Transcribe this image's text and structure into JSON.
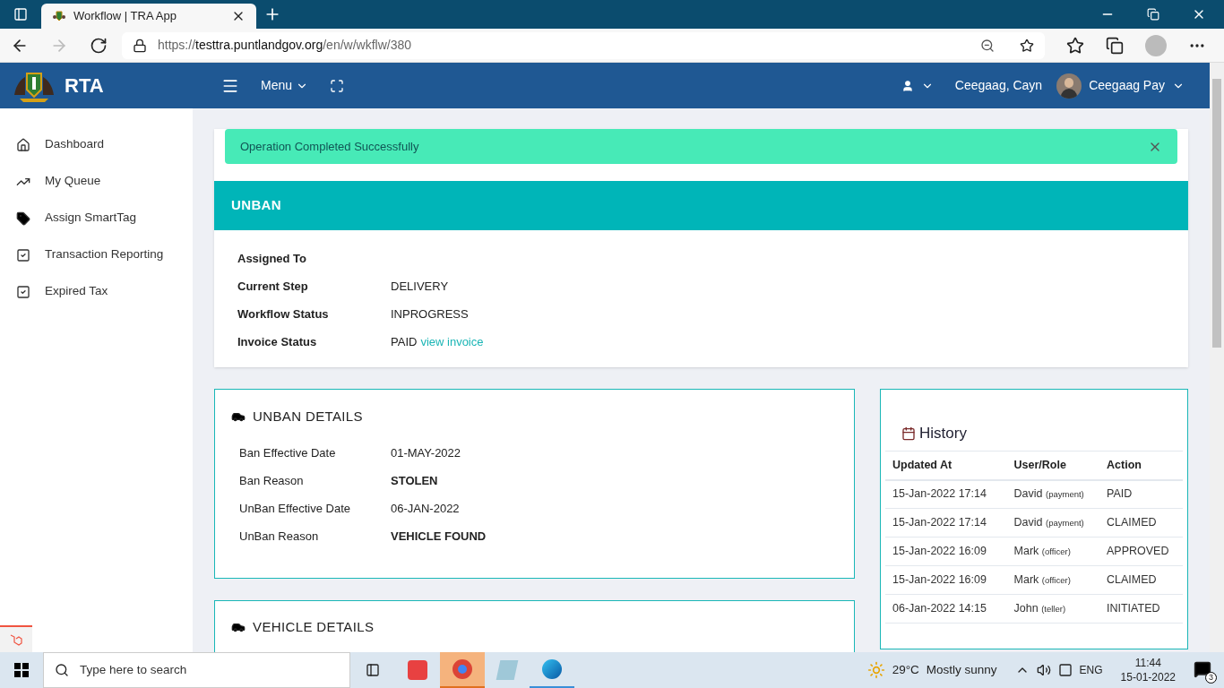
{
  "browser": {
    "tab_title": "Workflow | TRA App",
    "url_scheme": "https://",
    "url_host": "testtra.puntlandgov.org",
    "url_path": "/en/w/wkflw/380"
  },
  "header": {
    "brand": "RTA",
    "menu": "Menu",
    "user_name": "Ceegaag, Cayn",
    "account": "Ceegaag Pay"
  },
  "sidebar": {
    "items": [
      {
        "label": "Dashboard",
        "kind": "home"
      },
      {
        "label": "My Queue",
        "kind": "trend"
      },
      {
        "label": "Assign SmartTag",
        "kind": "tag"
      },
      {
        "label": "Transaction Reporting",
        "kind": "check"
      },
      {
        "label": "Expired Tax",
        "kind": "check"
      }
    ]
  },
  "alert": {
    "text": "Operation Completed Successfully"
  },
  "workflow": {
    "title": "UNBAN",
    "fields": [
      {
        "label": "Assigned To"
      },
      {
        "label": "Current Step",
        "value": "DELIVERY"
      },
      {
        "label": "Workflow Status",
        "value": "INPROGRESS"
      },
      {
        "label": "Invoice Status",
        "value": "PAID",
        "link": "view invoice"
      }
    ]
  },
  "unban_details": {
    "title": "UNBAN DETAILS",
    "rows": [
      {
        "label": "Ban Effective Date",
        "value": "01-MAY-2022",
        "bold": false
      },
      {
        "label": "Ban Reason",
        "value": "STOLEN",
        "bold": true
      },
      {
        "label": "UnBan Effective Date",
        "value": "06-JAN-2022",
        "bold": false
      },
      {
        "label": "UnBan Reason",
        "value": "VEHICLE FOUND",
        "bold": true
      }
    ]
  },
  "vehicle_details": {
    "title": "VEHICLE DETAILS"
  },
  "history": {
    "title": "History",
    "columns": [
      "Updated At",
      "User/Role",
      "Action"
    ],
    "rows": [
      {
        "updated_at": "15-Jan-2022 17:14",
        "user": "David",
        "role": "(payment)",
        "action": "PAID"
      },
      {
        "updated_at": "15-Jan-2022 17:14",
        "user": "David",
        "role": "(payment)",
        "action": "CLAIMED"
      },
      {
        "updated_at": "15-Jan-2022 16:09",
        "user": "Mark",
        "role": "(officer)",
        "action": "APPROVED"
      },
      {
        "updated_at": "15-Jan-2022 16:09",
        "user": "Mark",
        "role": "(officer)",
        "action": "CLAIMED"
      },
      {
        "updated_at": "06-Jan-2022 14:15",
        "user": "John",
        "role": "(teller)",
        "action": "INITIATED"
      }
    ]
  },
  "taskbar": {
    "search_placeholder": "Type here to search",
    "temperature": "29°C",
    "weather": "Mostly sunny",
    "language": "ENG",
    "time": "11:44",
    "date": "15-01-2022",
    "notifications": "3"
  }
}
